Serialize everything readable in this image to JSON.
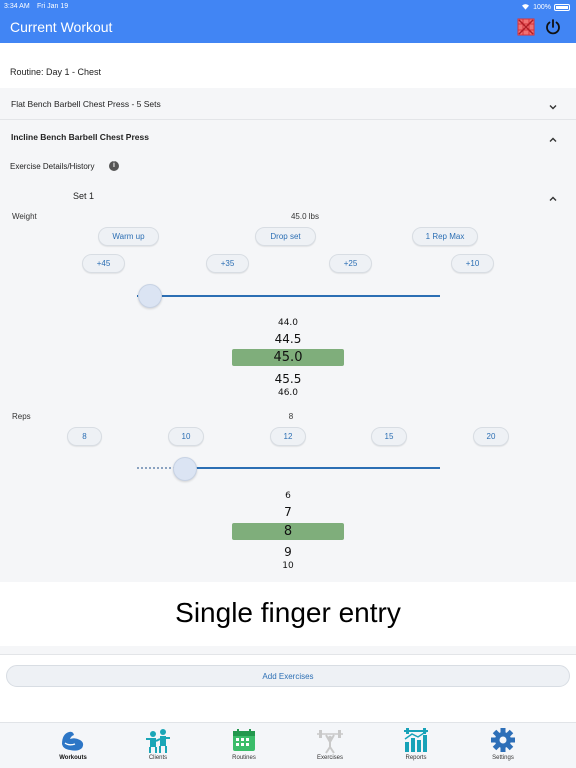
{
  "status_bar": {
    "time": "3:34 AM",
    "date": "Fri Jan 19",
    "battery": "100%"
  },
  "header": {
    "title": "Current Workout",
    "icons": [
      "grid-icon",
      "power-icon"
    ]
  },
  "routine": {
    "label": "Routine: Day 1 - Chest"
  },
  "exercises": [
    {
      "name": "Flat Bench Barbell Chest Press - 5 Sets",
      "expanded": false
    },
    {
      "name": "Incline Bench Barbell Chest Press",
      "expanded": true
    }
  ],
  "details": {
    "label": "Exercise Details/History"
  },
  "set": {
    "label": "Set 1"
  },
  "weight": {
    "label": "Weight",
    "value": "45.0 lbs",
    "presets": [
      "Warm up",
      "Drop set",
      "1 Rep Max"
    ],
    "increments": [
      "+45",
      "+35",
      "+25",
      "+10"
    ],
    "slider_fraction": 0.04,
    "picker": [
      "44.0",
      "44.5",
      "45.0",
      "45.5",
      "46.0"
    ]
  },
  "reps": {
    "label": "Reps",
    "value": "8",
    "quick": [
      "8",
      "10",
      "12",
      "15",
      "20"
    ],
    "slider_fraction": 0.16,
    "picker": [
      "6",
      "7",
      "8",
      "9",
      "10"
    ]
  },
  "banner": {
    "text": "Single finger entry"
  },
  "add_button": {
    "label": "Add Exercises"
  },
  "nav": [
    {
      "label": "Workouts",
      "icon": "arm-icon",
      "active": true
    },
    {
      "label": "Clients",
      "icon": "clients-icon",
      "active": false
    },
    {
      "label": "Routines",
      "icon": "calendar-icon",
      "active": false
    },
    {
      "label": "Exercises",
      "icon": "barbell-icon",
      "active": false
    },
    {
      "label": "Reports",
      "icon": "reports-icon",
      "active": false
    },
    {
      "label": "Settings",
      "icon": "gear-icon",
      "active": false
    }
  ],
  "colors": {
    "accent": "#4185f4",
    "link": "#2c6fb4",
    "selection": "#7fae7b",
    "panel": "#f5f6f8"
  }
}
